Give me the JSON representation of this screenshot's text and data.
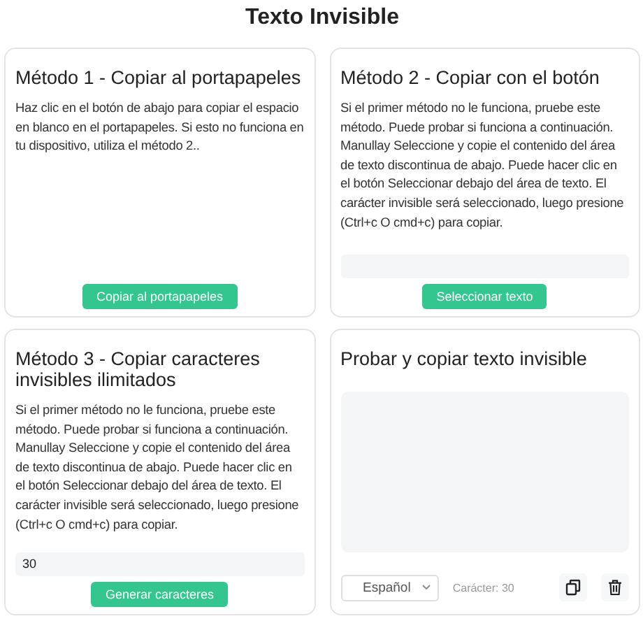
{
  "title": "Texto Invisible",
  "cards": [
    {
      "kind": "method",
      "title": "Método 1 - Copiar al portapapeles",
      "text": "Haz clic en el botón de abajo para copiar el espacio en blanco en el portapapeles. Si esto no funciona en tu dispositivo, utiliza el método 2..",
      "button": "Copiar al portapapeles"
    },
    {
      "kind": "method",
      "title": "Método 2 - Copiar con el botón",
      "text": "Si el primer método no le funciona, pruebe este método. Puede probar si funciona a continuación. Manullay Seleccione y copie el contenido del área de texto discontinua de abajo. Puede hacer clic en el botón Seleccionar debajo del área de texto. El carácter invisible será seleccionado, luego presione (Ctrl+c O cmd+c) para copiar.",
      "field_shown": true,
      "button": "Seleccionar texto"
    },
    {
      "kind": "method",
      "title": "Método 3 - Copiar caracteres invisibles ilimitados",
      "text": "Si el primer método no le funciona, pruebe este método. Puede probar si funciona a continuación. Manullay Seleccione y copie el contenido del área de texto discontinua de abajo. Puede hacer clic en el botón Seleccionar debajo del área de texto. El carácter invisible será seleccionado, luego presione (Ctrl+c O cmd+c) para copiar.",
      "field_value": "30",
      "button": "Generar caracteres"
    },
    {
      "kind": "tester",
      "title": "Probar y copiar texto invisible",
      "language": "Español",
      "count": "Carácter: 30"
    }
  ]
}
